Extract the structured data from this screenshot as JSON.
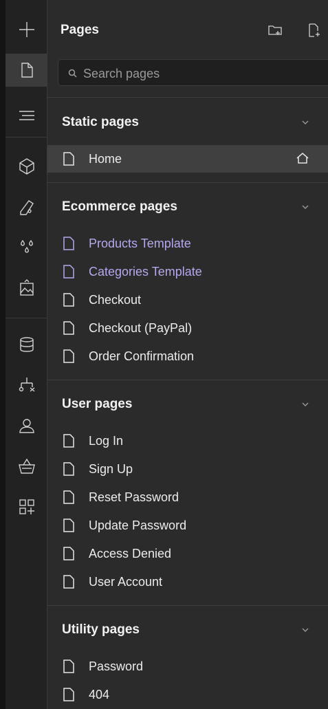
{
  "rail": {
    "items": [
      {
        "name": "add-icon",
        "active": false
      },
      {
        "name": "pages-icon",
        "active": true
      },
      {
        "name": "navigator-icon",
        "active": false
      },
      {
        "name": "components-icon",
        "active": false
      },
      {
        "name": "style-manager-icon",
        "active": false
      },
      {
        "name": "variables-icon",
        "active": false
      },
      {
        "name": "assets-icon",
        "active": false
      },
      {
        "name": "cms-icon",
        "active": false
      },
      {
        "name": "logic-icon",
        "active": false
      },
      {
        "name": "users-icon",
        "active": false
      },
      {
        "name": "ecommerce-icon",
        "active": false
      },
      {
        "name": "apps-icon",
        "active": false
      }
    ]
  },
  "panel": {
    "title": "Pages",
    "actions": [
      "new-folder-icon",
      "new-page-icon"
    ]
  },
  "search": {
    "placeholder": "Search pages",
    "value": ""
  },
  "sections": [
    {
      "title": "Static pages",
      "pages": [
        {
          "label": "Home",
          "selected": true,
          "home": true,
          "template": false
        }
      ]
    },
    {
      "title": "Ecommerce pages",
      "pages": [
        {
          "label": "Products Template",
          "template": true
        },
        {
          "label": "Categories Template",
          "template": true
        },
        {
          "label": "Checkout",
          "template": false
        },
        {
          "label": "Checkout (PayPal)",
          "template": false
        },
        {
          "label": "Order Confirmation",
          "template": false
        }
      ]
    },
    {
      "title": "User pages",
      "pages": [
        {
          "label": "Log In",
          "template": false
        },
        {
          "label": "Sign Up",
          "template": false
        },
        {
          "label": "Reset Password",
          "template": false
        },
        {
          "label": "Update Password",
          "template": false
        },
        {
          "label": "Access Denied",
          "template": false
        },
        {
          "label": "User Account",
          "template": false
        }
      ]
    },
    {
      "title": "Utility pages",
      "pages": [
        {
          "label": "Password",
          "template": false
        },
        {
          "label": "404",
          "template": false
        }
      ]
    }
  ],
  "colors": {
    "template_page": "#b7a8ee",
    "selected_row": "#404040",
    "background": "#2b2b2b",
    "rail": "#222222"
  }
}
